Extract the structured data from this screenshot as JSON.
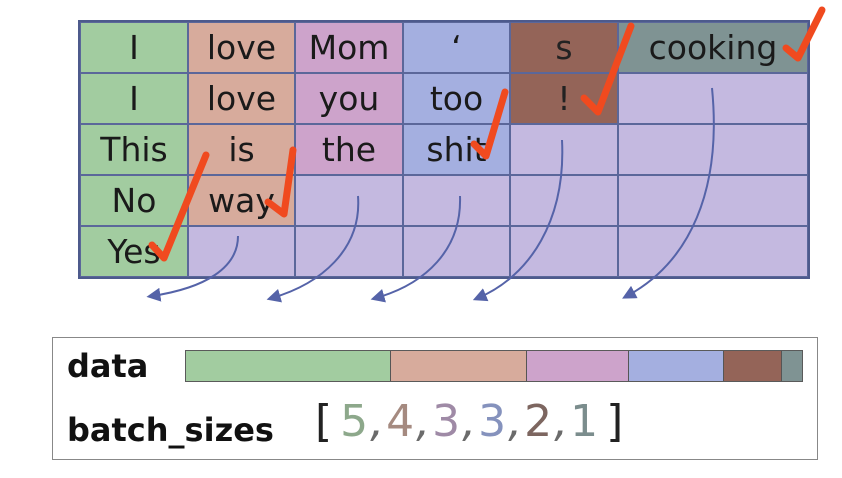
{
  "grid": {
    "rows": [
      [
        {
          "text": "I",
          "color": "green"
        },
        {
          "text": "love",
          "color": "salmon"
        },
        {
          "text": "Mom",
          "color": "pink"
        },
        {
          "text": "‘",
          "color": "blue"
        },
        {
          "text": "s",
          "color": "brown"
        },
        {
          "text": "cooking",
          "color": "slate"
        }
      ],
      [
        {
          "text": "I",
          "color": "green"
        },
        {
          "text": "love",
          "color": "salmon"
        },
        {
          "text": "you",
          "color": "pink"
        },
        {
          "text": "too",
          "color": "blue"
        },
        {
          "text": "!",
          "color": "brown"
        },
        {
          "text": "",
          "color": "empty"
        }
      ],
      [
        {
          "text": "This",
          "color": "green"
        },
        {
          "text": "is",
          "color": "salmon"
        },
        {
          "text": "the",
          "color": "pink"
        },
        {
          "text": "shit",
          "color": "blue"
        },
        {
          "text": "",
          "color": "empty"
        },
        {
          "text": "",
          "color": "empty"
        }
      ],
      [
        {
          "text": "No",
          "color": "green"
        },
        {
          "text": "way",
          "color": "salmon"
        },
        {
          "text": "",
          "color": "empty"
        },
        {
          "text": "",
          "color": "empty"
        },
        {
          "text": "",
          "color": "empty"
        },
        {
          "text": "",
          "color": "empty"
        }
      ],
      [
        {
          "text": "Yes",
          "color": "green"
        },
        {
          "text": "",
          "color": "empty"
        },
        {
          "text": "",
          "color": "empty"
        },
        {
          "text": "",
          "color": "empty"
        },
        {
          "text": "",
          "color": "empty"
        },
        {
          "text": "",
          "color": "empty"
        }
      ]
    ]
  },
  "colors": {
    "green": "#a2cca0",
    "salmon": "#d7ab9c",
    "pink": "#cda3cb",
    "blue": "#a4afe0",
    "brown": "#946458",
    "slate": "#7f9393",
    "empty": "#c4b9e0",
    "checkmark": "#f04a1f",
    "arrow": "#5563a8"
  },
  "data_label": "data",
  "data_bar": [
    {
      "color": "green",
      "value": 5
    },
    {
      "color": "salmon",
      "value": 4
    },
    {
      "color": "pink",
      "value": 3
    },
    {
      "color": "blue",
      "value": 3
    },
    {
      "color": "brown",
      "value": 2
    },
    {
      "color": "slate",
      "value": 1
    }
  ],
  "batch_label": "batch_sizes",
  "batch_sizes": [
    {
      "value": "5",
      "color": "#8da88b"
    },
    {
      "value": "4",
      "color": "#a58a80"
    },
    {
      "value": "3",
      "color": "#9f8aa6"
    },
    {
      "value": "3",
      "color": "#8592bd"
    },
    {
      "value": "2",
      "color": "#7d6660"
    },
    {
      "value": "1",
      "color": "#7b8d8d"
    }
  ],
  "open_bracket": "[",
  "close_bracket": "]",
  "separator": ","
}
